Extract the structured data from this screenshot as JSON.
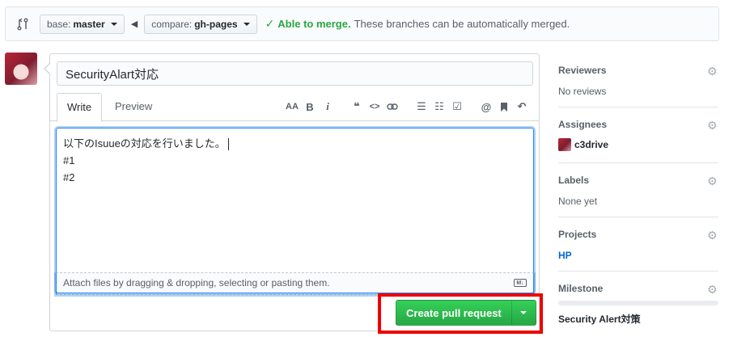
{
  "compare": {
    "base_prefix": "base:",
    "base_branch": "master",
    "compare_prefix": "compare:",
    "compare_branch": "gh-pages",
    "merge_status": "Able to merge.",
    "merge_message": "These branches can be automatically merged."
  },
  "editor": {
    "title_value": "SecurityAlart対応",
    "tabs": [
      {
        "label": "Write"
      },
      {
        "label": "Preview"
      }
    ],
    "toolbar": {
      "heading": "AA",
      "bold": "B",
      "italic": "i",
      "quote": "❝",
      "code": "<>",
      "link": "🔗",
      "ul": "☰",
      "ol": "☷",
      "tasks": "☑",
      "mention": "@",
      "bookmark": "🔖",
      "reply": "↶"
    },
    "body_lines": [
      "以下のIsuueの対応を行いました。",
      "#1",
      "#2"
    ],
    "attach_text": "Attach files by dragging & dropping, selecting or pasting them.",
    "md_badge": "M↓",
    "create_label": "Create pull request"
  },
  "sidebar": {
    "reviewers": {
      "title": "Reviewers",
      "value": "No reviews"
    },
    "assignees": {
      "title": "Assignees",
      "user": "c3drive"
    },
    "labels": {
      "title": "Labels",
      "value": "None yet"
    },
    "projects": {
      "title": "Projects",
      "value": "HP"
    },
    "milestone": {
      "title": "Milestone",
      "value": "Security Alert対策",
      "progress": 0
    }
  },
  "colors": {
    "green": "#28a745",
    "highlight": "#f00000",
    "link": "#0366d6"
  }
}
